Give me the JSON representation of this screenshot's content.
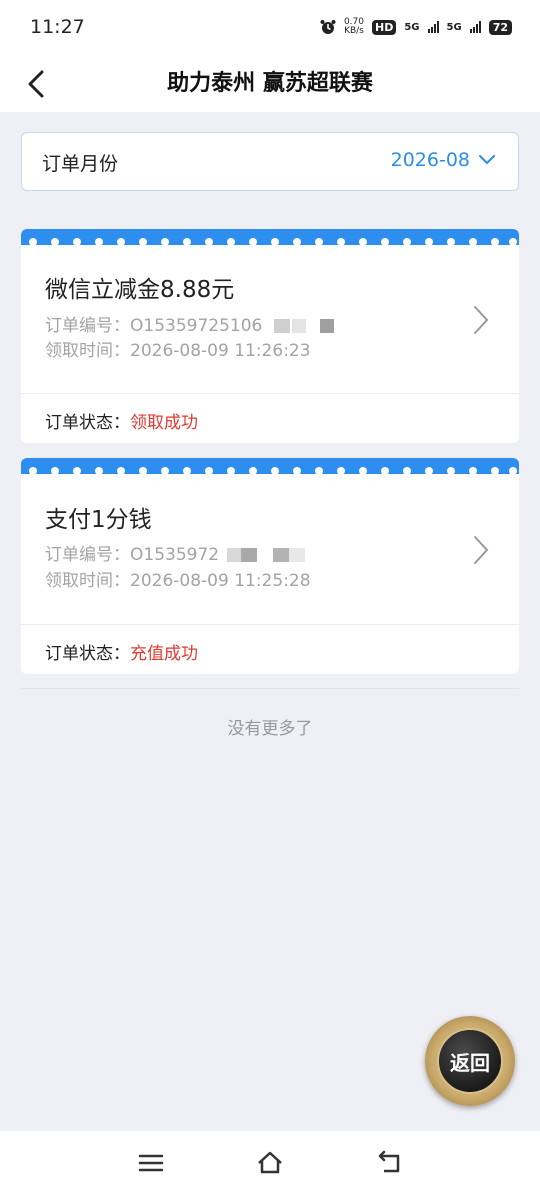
{
  "status_bar": {
    "time": "11:27",
    "net_speed_value": "0.70",
    "net_speed_unit": "KB/s",
    "hd_label": "HD",
    "signal1_label": "5G",
    "signal2_label": "5G",
    "battery": "72",
    "icons": [
      "alarm-icon",
      "hd-icon",
      "signal-icon",
      "signal-icon",
      "battery-icon"
    ]
  },
  "navbar": {
    "title": "助力泰州 赢苏超联赛",
    "back_icon": "chevron-left-icon"
  },
  "filter": {
    "label": "订单月份",
    "value": "2026-08",
    "icon": "chevron-down-icon"
  },
  "orders": [
    {
      "title": "微信立减金8.88元",
      "order_no_label": "订单编号：",
      "order_no": "O15359725106",
      "time_label": "领取时间：",
      "time": "2026-08-09 11:26:23",
      "status_label": "订单状态：",
      "status": "领取成功"
    },
    {
      "title": "支付1分钱",
      "order_no_label": "订单编号：",
      "order_no": "O1535972",
      "time_label": "领取时间：",
      "time": "2026-08-09 11:25:28",
      "status_label": "订单状态：",
      "status": "充值成功"
    }
  ],
  "footer_text": "没有更多了",
  "return_button": "返回",
  "bottom_nav": [
    "menu-icon",
    "home-icon",
    "back-icon"
  ],
  "colors": {
    "accent": "#2b8ee6",
    "card_band": "#2d8ef0",
    "status_red": "#e23a2e",
    "background": "#eff0f5"
  }
}
